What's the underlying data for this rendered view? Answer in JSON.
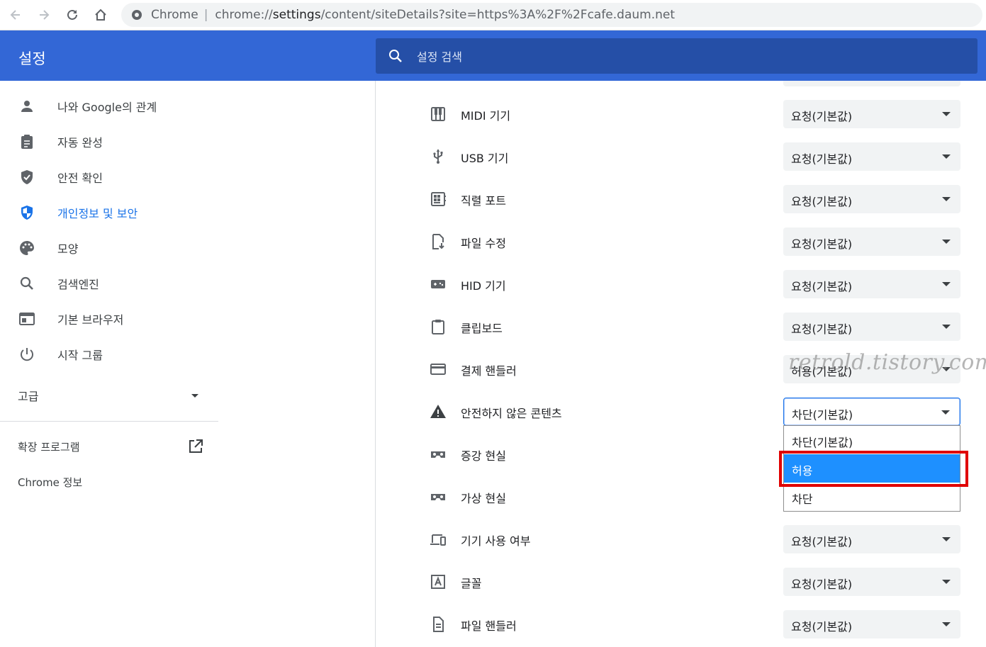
{
  "toolbar": {
    "site_chip": "Chrome",
    "url_prefix": "chrome://",
    "url_host": "settings",
    "url_rest": "/content/siteDetails?site=https%3A%2F%2Fcafe.daum.net"
  },
  "header": {
    "title": "설정",
    "search_placeholder": "설정 검색"
  },
  "sidebar": {
    "items": [
      {
        "label": "나와 Google의 관계",
        "icon": "person-icon"
      },
      {
        "label": "자동 완성",
        "icon": "clipboard-icon"
      },
      {
        "label": "안전 확인",
        "icon": "shield-check-icon"
      },
      {
        "label": "개인정보 및 보안",
        "icon": "shield-half-icon",
        "active": true
      },
      {
        "label": "모양",
        "icon": "palette-icon"
      },
      {
        "label": "검색엔진",
        "icon": "search-icon"
      },
      {
        "label": "기본 브라우저",
        "icon": "browser-icon"
      },
      {
        "label": "시작 그룹",
        "icon": "power-icon"
      }
    ],
    "advanced": "고급",
    "extensions": "확장 프로그램",
    "about": "Chrome 정보"
  },
  "rows": [
    {
      "label": "MIDI 기기",
      "value": "요청(기본값)",
      "icon": "piano-icon"
    },
    {
      "label": "USB 기기",
      "value": "요청(기본값)",
      "icon": "usb-icon"
    },
    {
      "label": "직렬 포트",
      "value": "요청(기본값)",
      "icon": "serial-port-icon"
    },
    {
      "label": "파일 수정",
      "value": "요청(기본값)",
      "icon": "file-edit-icon"
    },
    {
      "label": "HID 기기",
      "value": "요청(기본값)",
      "icon": "gamepad-icon"
    },
    {
      "label": "클립보드",
      "value": "요청(기본값)",
      "icon": "clipboard-icon"
    },
    {
      "label": "결제 핸들러",
      "value": "허용(기본값)",
      "icon": "credit-card-icon"
    },
    {
      "label": "안전하지 않은 콘텐츠",
      "value": "차단(기본값)",
      "icon": "warning-icon",
      "open": true
    },
    {
      "label": "증강 현실",
      "value": "",
      "icon": "vr-headset-icon"
    },
    {
      "label": "가상 현실",
      "value": "",
      "icon": "vr-headset-icon"
    },
    {
      "label": "기기 사용 여부",
      "value": "요청(기본값)",
      "icon": "devices-icon"
    },
    {
      "label": "글꼴",
      "value": "요청(기본값)",
      "icon": "font-icon"
    },
    {
      "label": "파일 핸들러",
      "value": "요청(기본값)",
      "icon": "document-icon"
    }
  ],
  "dropdown": {
    "options": [
      "차단(기본값)",
      "허용",
      "차단"
    ],
    "highlighted": "허용"
  },
  "watermark": "retrold.tistory.com",
  "colors": {
    "header": "#3367d6",
    "search": "#254fa7",
    "accent": "#1a73e8",
    "dropdown_selected": "#1e90ff",
    "highlight_box": "#e00000"
  }
}
